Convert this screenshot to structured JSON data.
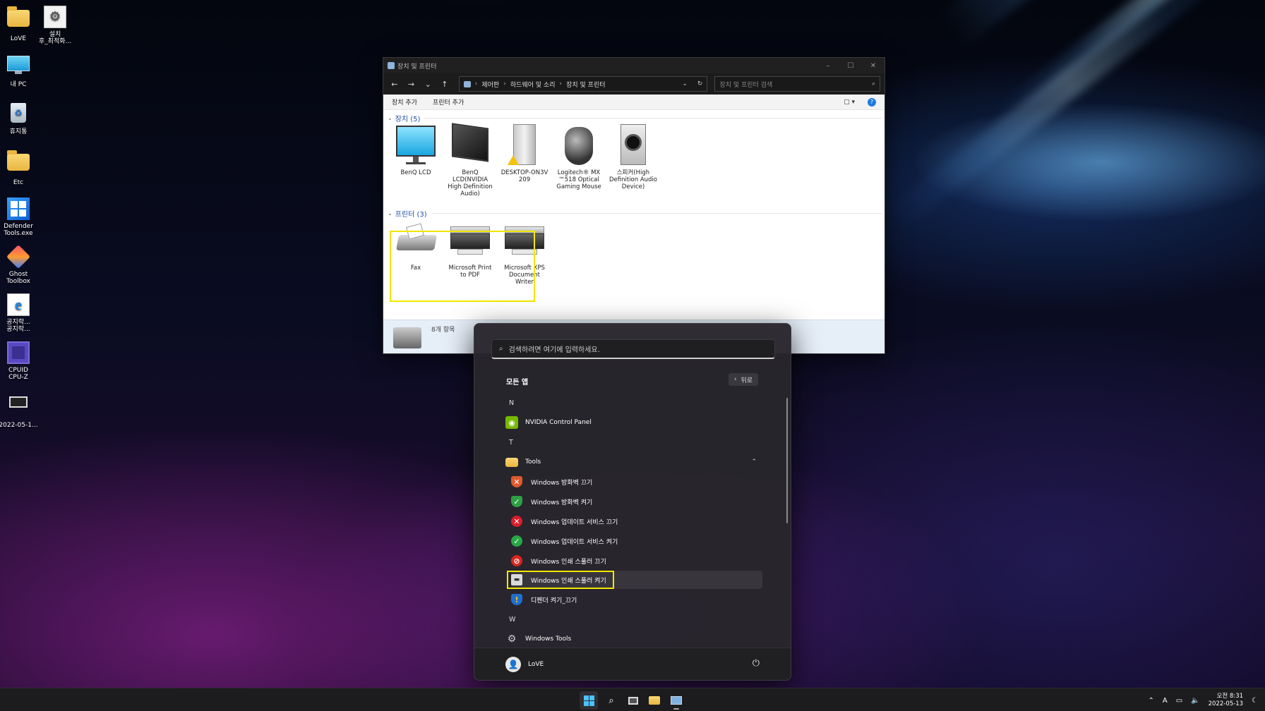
{
  "desktop": {
    "icons": [
      {
        "label": "LoVE",
        "icon": "folder-icon"
      },
      {
        "label": "설치\n후_최적화...",
        "icon": "settings-shortcut-icon"
      },
      {
        "label": "내 PC",
        "icon": "monitor-icon"
      },
      {
        "label": "휴지통",
        "icon": "recycle-bin-icon"
      },
      {
        "label": "Etc",
        "icon": "folder-icon"
      },
      {
        "label": "Defender\nTools.exe",
        "icon": "defender-tools-icon"
      },
      {
        "label": "Ghost\nToolbox",
        "icon": "ghost-toolbox-icon"
      },
      {
        "label": "공지락...\n공지락...",
        "icon": "ie-icon"
      },
      {
        "label": "CPUID\nCPU-Z",
        "icon": "cpuz-icon"
      },
      {
        "label": "2022-05-1...",
        "icon": "screenshot-icon"
      }
    ]
  },
  "explorer": {
    "title": "장치 및 프린터",
    "address": {
      "parts": [
        "제어판",
        "하드웨어 및 소리",
        "장치 및 프린터"
      ]
    },
    "search_placeholder": "장치 및 프린터 검색",
    "commands": {
      "add_device": "장치 추가",
      "add_printer": "프린터 추가"
    },
    "devices_group": "장치 (5)",
    "devices": [
      {
        "label": "BenQ LCD",
        "icon": "monitor-icon"
      },
      {
        "label": "BenQ\nLCD(NVIDIA\nHigh Definition\nAudio)",
        "icon": "monitor-audio-icon"
      },
      {
        "label": "DESKTOP-ON3V\n209",
        "icon": "computer-tower-icon"
      },
      {
        "label": "Logitech® MX\n™518 Optical\nGaming Mouse",
        "icon": "mouse-icon"
      },
      {
        "label": "스피커(High\nDefinition Audio\nDevice)",
        "icon": "speaker-icon"
      }
    ],
    "printers_group": "프린터 (3)",
    "printers": [
      {
        "label": "Fax",
        "icon": "fax-icon"
      },
      {
        "label": "Microsoft Print\nto PDF",
        "icon": "printer-icon"
      },
      {
        "label": "Microsoft XPS\nDocument\nWriter",
        "icon": "printer-icon"
      }
    ],
    "status": "8개 항목"
  },
  "start_menu": {
    "search_placeholder": "검색하려면 여기에 입력하세요.",
    "all_apps": "모든 앱",
    "back": "뒤로",
    "sections": [
      {
        "letter": "N"
      },
      {
        "letter": "T"
      },
      {
        "letter": "W"
      }
    ],
    "apps": {
      "nvidia": "NVIDIA Control Panel",
      "tools": "Tools",
      "fw_off": "Windows 방화벽 끄기",
      "fw_on": "Windows 방화벽 켜기",
      "wu_off": "Windows 업데이트 서비스 끄기",
      "wu_on": "Windows 업데이트 서비스 켜기",
      "spool_off": "Windows 인쇄 스풀러 끄기",
      "spool_on": "Windows 인쇄 스풀러 켜기",
      "defender": "디펜더 켜기_끄기",
      "wintools": "Windows Tools"
    },
    "user": "LoVE"
  },
  "taskbar": {
    "time": "오전 8:31",
    "date": "2022-05-13",
    "ime": "A"
  },
  "colors": {
    "highlight": "#f2e600",
    "accent": "#1e7be0"
  }
}
